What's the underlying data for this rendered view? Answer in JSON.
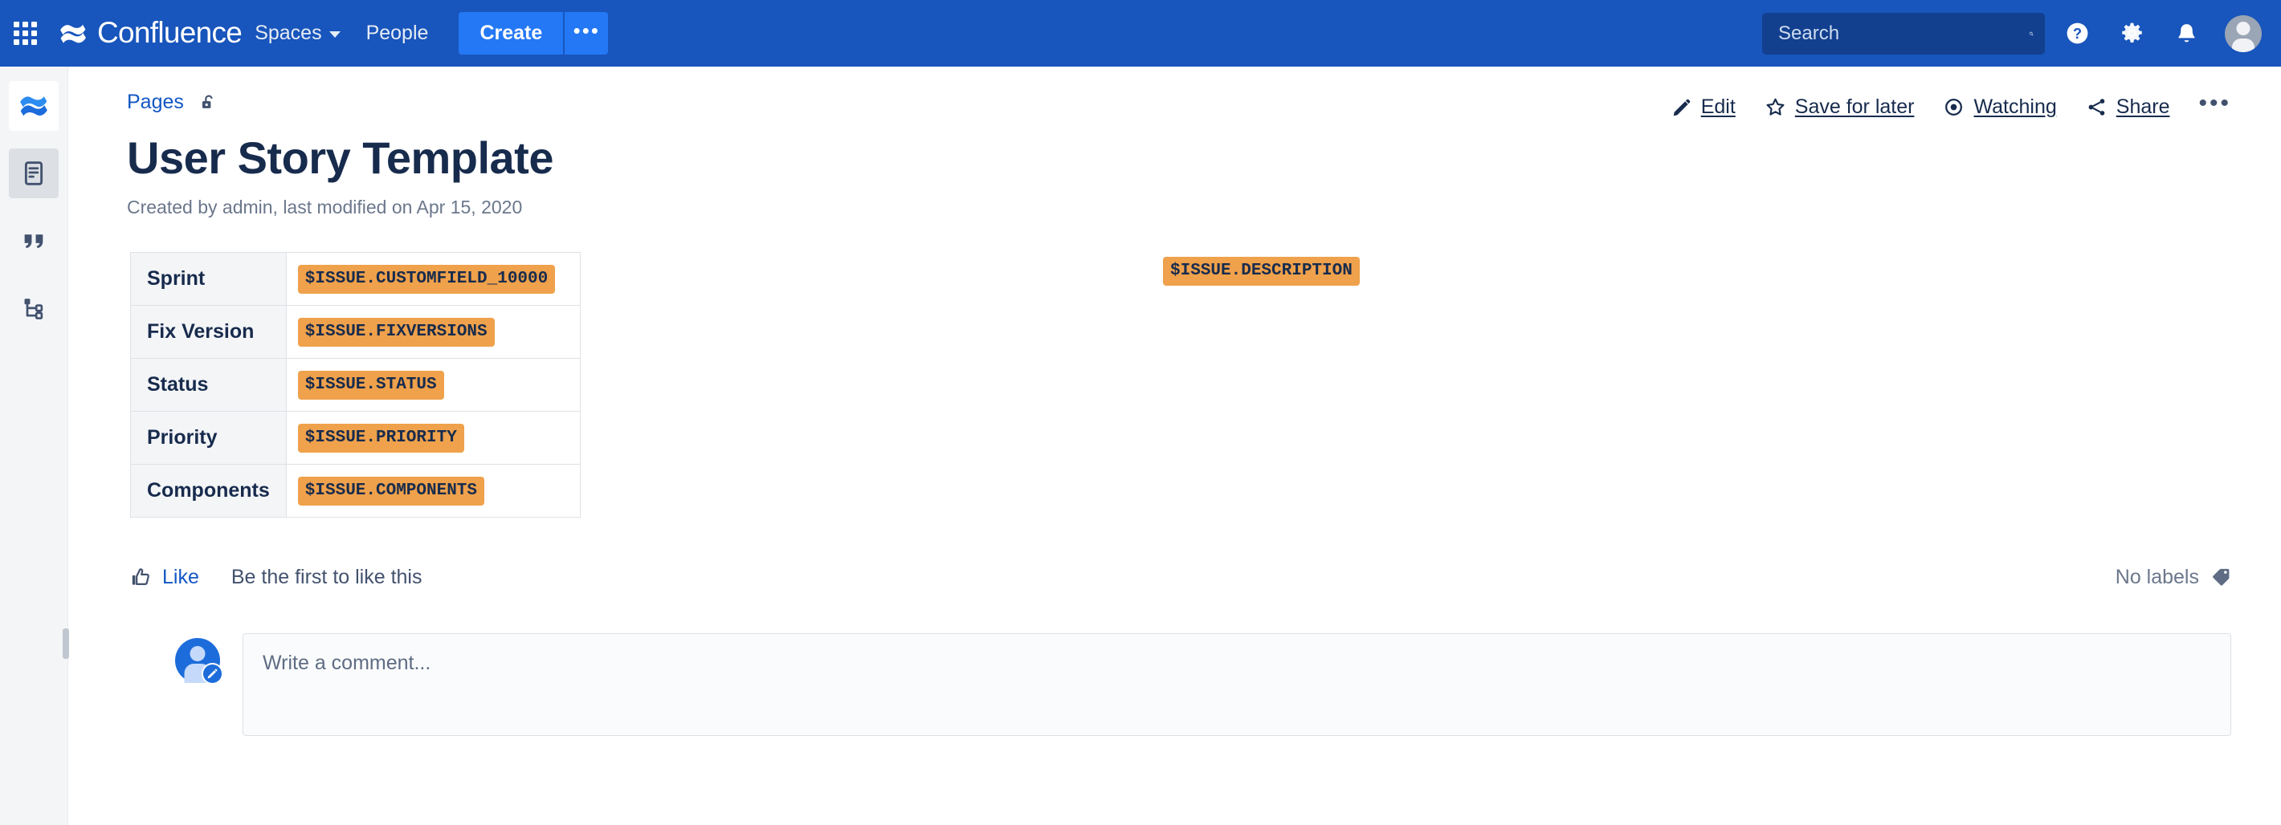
{
  "topnav": {
    "app_switcher": "app-switcher",
    "brand": "Confluence",
    "links": [
      {
        "label": "Spaces",
        "has_caret": true
      },
      {
        "label": "People",
        "has_caret": false
      }
    ],
    "create_label": "Create",
    "create_more_label": "•••",
    "search_placeholder": "Search",
    "search_value": "",
    "icons": [
      "help-icon",
      "settings-gear-icon",
      "notifications-bell-icon",
      "profile-avatar"
    ]
  },
  "rail": {
    "items": [
      {
        "name": "space-home",
        "icon": "confluence-space-icon",
        "active": false
      },
      {
        "name": "pages",
        "icon": "pages-document-icon",
        "active": true
      },
      {
        "name": "blog",
        "icon": "blog-quote-icon",
        "active": false
      },
      {
        "name": "page-tree",
        "icon": "page-tree-icon",
        "active": false
      }
    ]
  },
  "page": {
    "breadcrumb": "Pages",
    "restrictions_icon": "unlocked-padlock-icon",
    "title": "User Story Template",
    "byline": "Created by admin, last modified on Apr 15, 2020"
  },
  "actions": {
    "edit": "Edit",
    "save_for_later": "Save for later",
    "watching": "Watching",
    "share": "Share",
    "more": "•••"
  },
  "table": {
    "rows": [
      {
        "key": "Sprint",
        "value": "$ISSUE.CUSTOMFIELD_10000"
      },
      {
        "key": "Fix Version",
        "value": "$ISSUE.FIXVERSIONS"
      },
      {
        "key": "Status",
        "value": "$ISSUE.STATUS"
      },
      {
        "key": "Priority",
        "value": "$ISSUE.PRIORITY"
      },
      {
        "key": "Components",
        "value": "$ISSUE.COMPONENTS"
      }
    ]
  },
  "description_chip": "$ISSUE.DESCRIPTION",
  "meta": {
    "like_label": "Like",
    "like_note": "Be the first to like this",
    "labels_text": "No labels"
  },
  "comment": {
    "placeholder": "Write a comment..."
  },
  "colors": {
    "nav_blue": "#1855BC",
    "create_blue": "#2478F5",
    "search_blue": "#12408F",
    "link_blue": "#1257C4",
    "chip_orange": "#EFA14B",
    "text_dark": "#172B4D",
    "muted": "#6b778c",
    "rail_bg": "#f4f5f7",
    "border": "#dfe1e6"
  }
}
